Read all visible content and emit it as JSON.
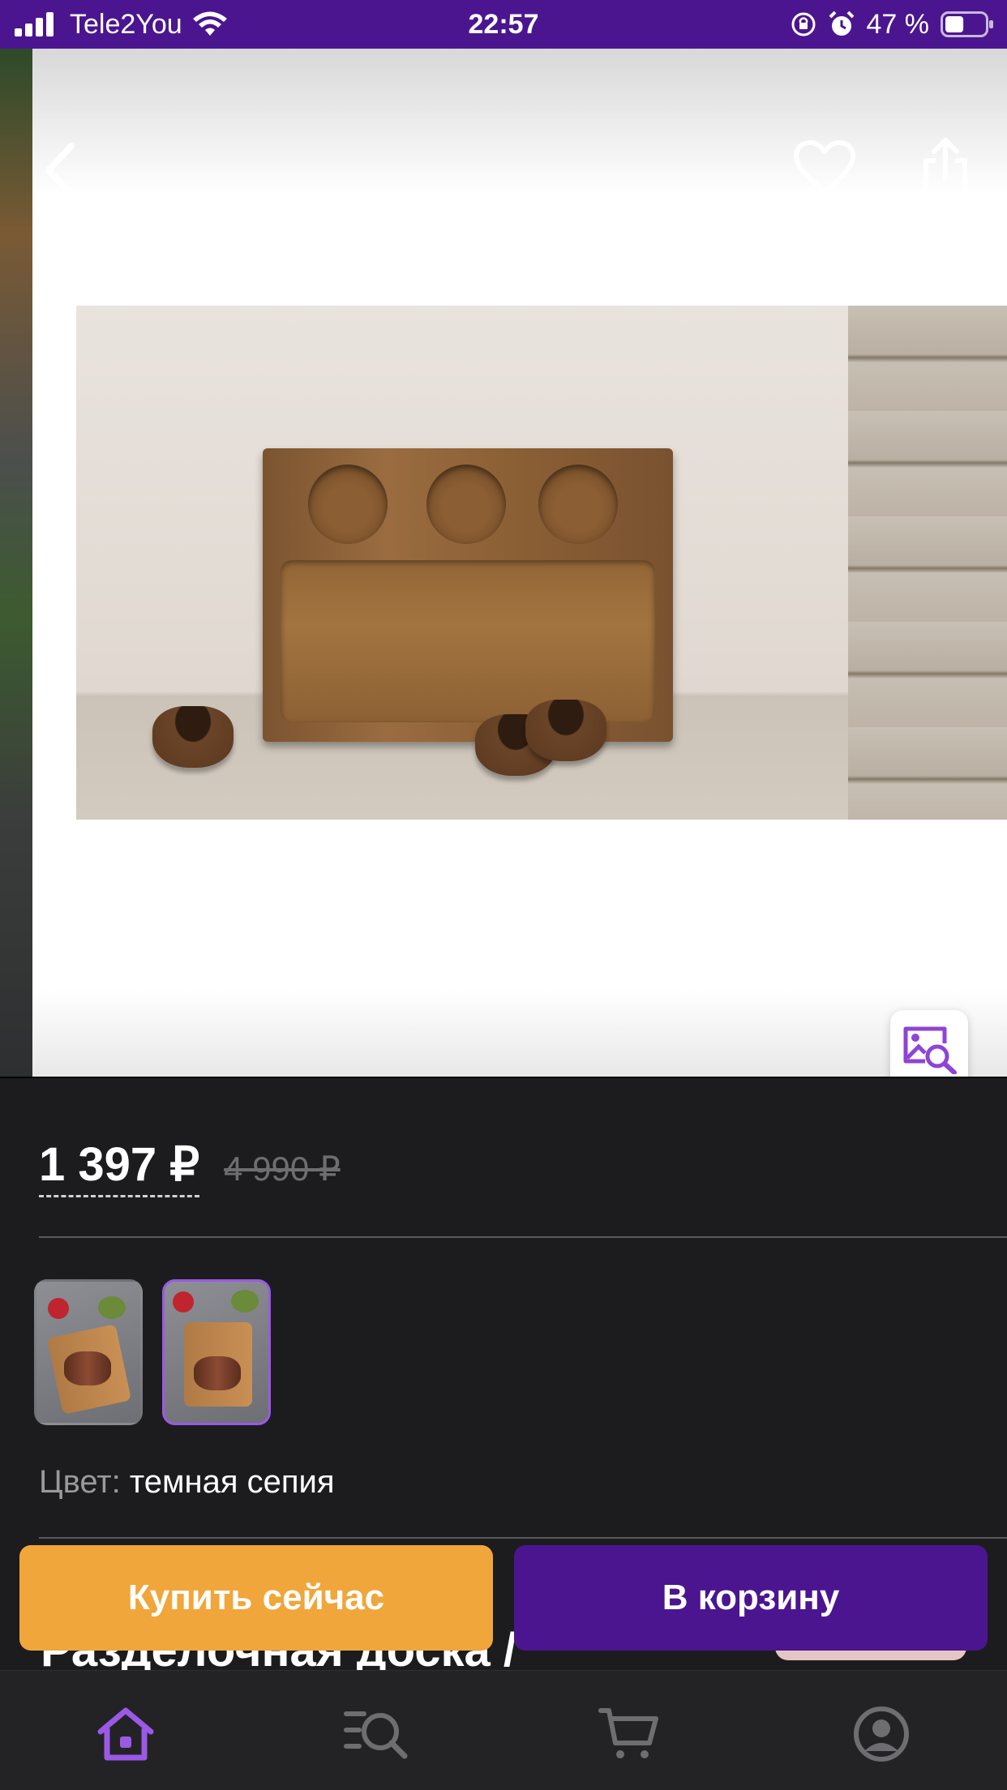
{
  "status_bar": {
    "carrier": "Tele2You",
    "time": "22:57",
    "battery_text": "47 %",
    "battery_level": 0.47
  },
  "gallery": {
    "back_icon": "chevron-left-icon",
    "favorite_icon": "heart-icon",
    "share_icon": "share-icon",
    "visual_search_icon": "image-search-icon"
  },
  "product": {
    "price": "1 397 ₽",
    "old_price": "4 990 ₽",
    "color_label": "Цвет:",
    "color_value": "темная сепия",
    "title_peek": "Разделочная доска /",
    "variants": [
      {
        "name": "variant-1",
        "selected": false
      },
      {
        "name": "variant-2",
        "selected": true
      }
    ]
  },
  "actions": {
    "buy_now": "Купить сейчас",
    "add_to_cart": "В корзину"
  },
  "tabbar": {
    "items": [
      {
        "icon": "home-icon",
        "active": true
      },
      {
        "icon": "catalog-search-icon",
        "active": false
      },
      {
        "icon": "cart-icon",
        "active": false
      },
      {
        "icon": "profile-icon",
        "active": false
      }
    ]
  },
  "colors": {
    "brand_purple": "#4b1590",
    "accent_orange": "#f0a63a",
    "active_tab": "#9b59e6",
    "panel_bg": "#1c1c1e"
  }
}
